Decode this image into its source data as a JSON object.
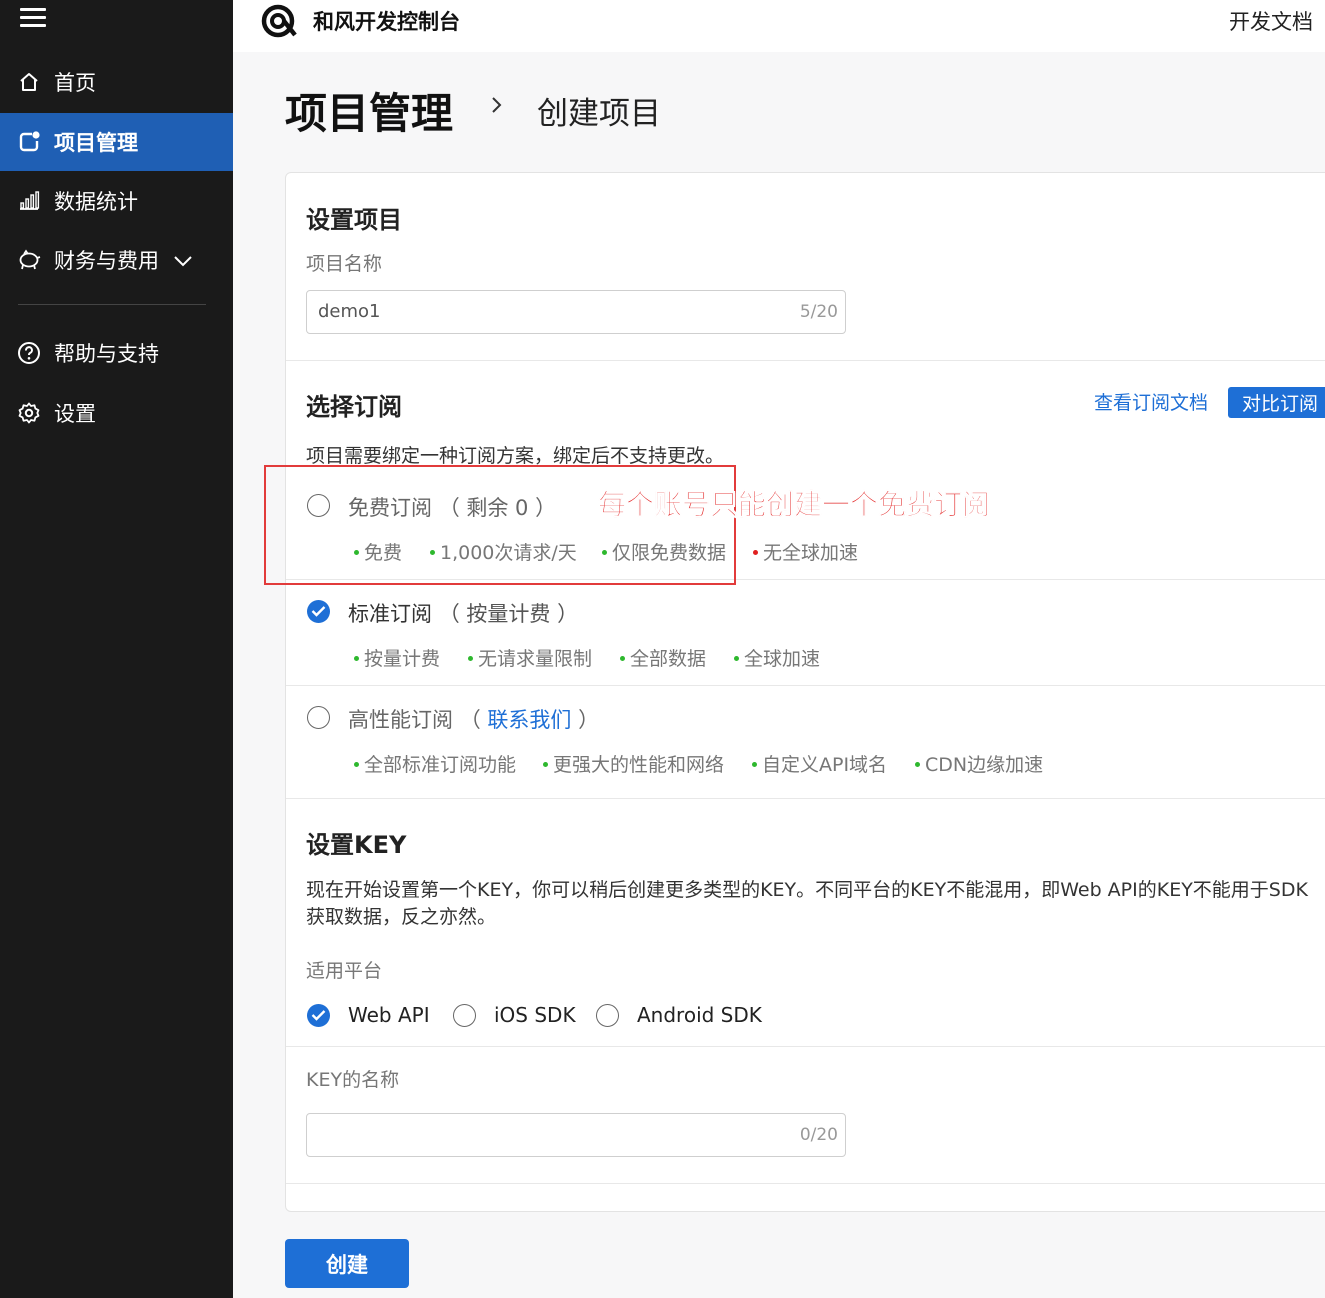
{
  "sidebar": {
    "items": [
      {
        "label": "首页",
        "icon": "home-icon"
      },
      {
        "label": "项目管理",
        "icon": "project-icon",
        "active": true
      },
      {
        "label": "数据统计",
        "icon": "bar-chart-icon"
      },
      {
        "label": "财务与费用",
        "icon": "piggy-bank-icon",
        "expandable": true
      },
      {
        "label": "帮助与支持",
        "icon": "help-icon"
      },
      {
        "label": "设置",
        "icon": "gear-icon"
      }
    ]
  },
  "topbar": {
    "brand": "和风开发控制台",
    "docs": "开发文档"
  },
  "breadcrumb": {
    "title": "项目管理",
    "current": "创建项目"
  },
  "project": {
    "section_title": "设置项目",
    "name_label": "项目名称",
    "name_value": "demo1",
    "name_count": "5/20"
  },
  "subscription": {
    "section_title": "选择订阅",
    "doc_link": "查看订阅文档",
    "compare_button": "对比订阅",
    "hint": "项目需要绑定一种订阅方案，绑定后不支持更改。",
    "plans": [
      {
        "name": "免费订阅",
        "paren_open": "（",
        "paren_note": "剩余 0",
        "paren_close": "）",
        "selected": false,
        "features": [
          "免费",
          "1,000次请求/天",
          "仅限免费数据",
          "无全球加速"
        ]
      },
      {
        "name": "标准订阅",
        "paren_open": "（",
        "paren_note": "按量计费",
        "paren_close": "）",
        "selected": true,
        "features": [
          "按量计费",
          "无请求量限制",
          "全部数据",
          "全球加速"
        ]
      },
      {
        "name": "高性能订阅",
        "paren_open": "（",
        "paren_note": "联系我们",
        "paren_close": "）",
        "selected": false,
        "features": [
          "全部标准订阅功能",
          "更强大的性能和网络",
          "自定义API域名",
          "CDN边缘加速"
        ]
      }
    ]
  },
  "key": {
    "section_title": "设置KEY",
    "description": "现在开始设置第一个KEY，你可以稍后创建更多类型的KEY。不同平台的KEY不能混用，即Web API的KEY不能用于SDK获取数据，反之亦然。",
    "platform_label": "适用平台",
    "platforms": [
      {
        "label": "Web API",
        "selected": true
      },
      {
        "label": "iOS SDK",
        "selected": false
      },
      {
        "label": "Android SDK",
        "selected": false
      }
    ],
    "name_label": "KEY的名称",
    "name_value": "",
    "name_count": "0/20"
  },
  "annotation": {
    "text": "每个账号只能创建一个免费订阅"
  },
  "create_button": "创建",
  "colors": {
    "sidebar_bg": "#1a1a1a",
    "active_nav": "#1f5fb4",
    "primary": "#1e6fd6",
    "feature_dot": "#2eb82e",
    "warn_dot": "#e02020",
    "annotation": "#e22222"
  }
}
